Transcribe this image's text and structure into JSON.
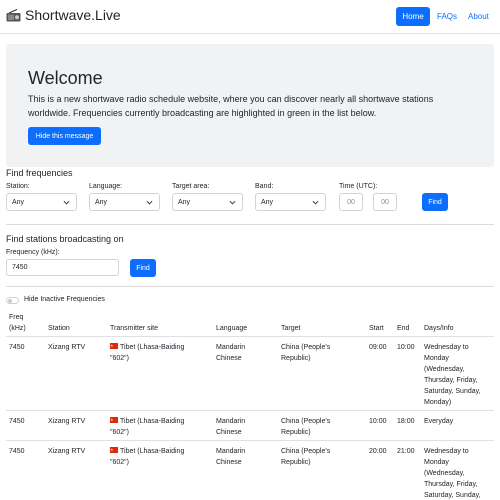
{
  "navbar": {
    "brand": "Shortwave.Live",
    "links": {
      "home": "Home",
      "faqs": "FAQs",
      "about": "About"
    }
  },
  "welcome": {
    "title": "Welcome",
    "text": "This is a new shortwave radio schedule website, where you can discover nearly all shortwave stations worldwide. Frequencies currently broadcasting are highlighted in green in the list below.",
    "hide_button": "Hide this message"
  },
  "find_frequencies": {
    "title": "Find frequencies",
    "station": {
      "label": "Station:",
      "value": "Any"
    },
    "language": {
      "label": "Language:",
      "value": "Any"
    },
    "target_area": {
      "label": "Target area:",
      "value": "Any"
    },
    "band": {
      "label": "Band:",
      "value": "Any"
    },
    "time": {
      "label": "Time (UTC):",
      "hour_placeholder": "00",
      "minute_placeholder": "00"
    },
    "find_button": "Find"
  },
  "find_stations": {
    "title": "Find stations broadcasting on",
    "frequency_label": "Frequency (kHz):",
    "frequency_value": "7450",
    "find_button": "Find"
  },
  "toggle": {
    "label": "Hide Inactive Frequencies",
    "checked": false
  },
  "table": {
    "headers": {
      "freq_line1": "Freq",
      "freq_line2": "(kHz)",
      "station": "Station",
      "site": "Transmitter site",
      "language": "Language",
      "target": "Target",
      "start": "Start",
      "end": "End",
      "days": "Days/Info"
    },
    "rows": [
      {
        "freq": "7450",
        "station": "Xizang RTV",
        "site_line1": "Tibet (Lhasa-Baiding",
        "site_line2": "\"602\")",
        "language_line1": "Mandarin",
        "language_line2": "Chinese",
        "target_line1": "China (People's",
        "target_line2": "Republic)",
        "start": "09:00",
        "end": "10:00",
        "days": [
          "Wednesday to",
          "Monday",
          "(Wednesday,",
          "Thursday, Friday,",
          "Saturday, Sunday,",
          "Monday)"
        ]
      },
      {
        "freq": "7450",
        "station": "Xizang RTV",
        "site_line1": "Tibet (Lhasa-Baiding",
        "site_line2": "\"602\")",
        "language_line1": "Mandarin",
        "language_line2": "Chinese",
        "target_line1": "China (People's",
        "target_line2": "Republic)",
        "start": "10:00",
        "end": "18:00",
        "days": [
          "Everyday"
        ]
      },
      {
        "freq": "7450",
        "station": "Xizang RTV",
        "site_line1": "Tibet (Lhasa-Baiding",
        "site_line2": "\"602\")",
        "language_line1": "Mandarin",
        "language_line2": "Chinese",
        "target_line1": "China (People's",
        "target_line2": "Republic)",
        "start": "20:00",
        "end": "21:00",
        "days": [
          "Wednesday to",
          "Monday",
          "(Wednesday,",
          "Thursday, Friday,",
          "Saturday, Sunday,"
        ]
      }
    ]
  },
  "colors": {
    "primary": "#0d6efd",
    "jumbotron_bg": "#f1f2f4",
    "flag_red": "#de2910"
  }
}
